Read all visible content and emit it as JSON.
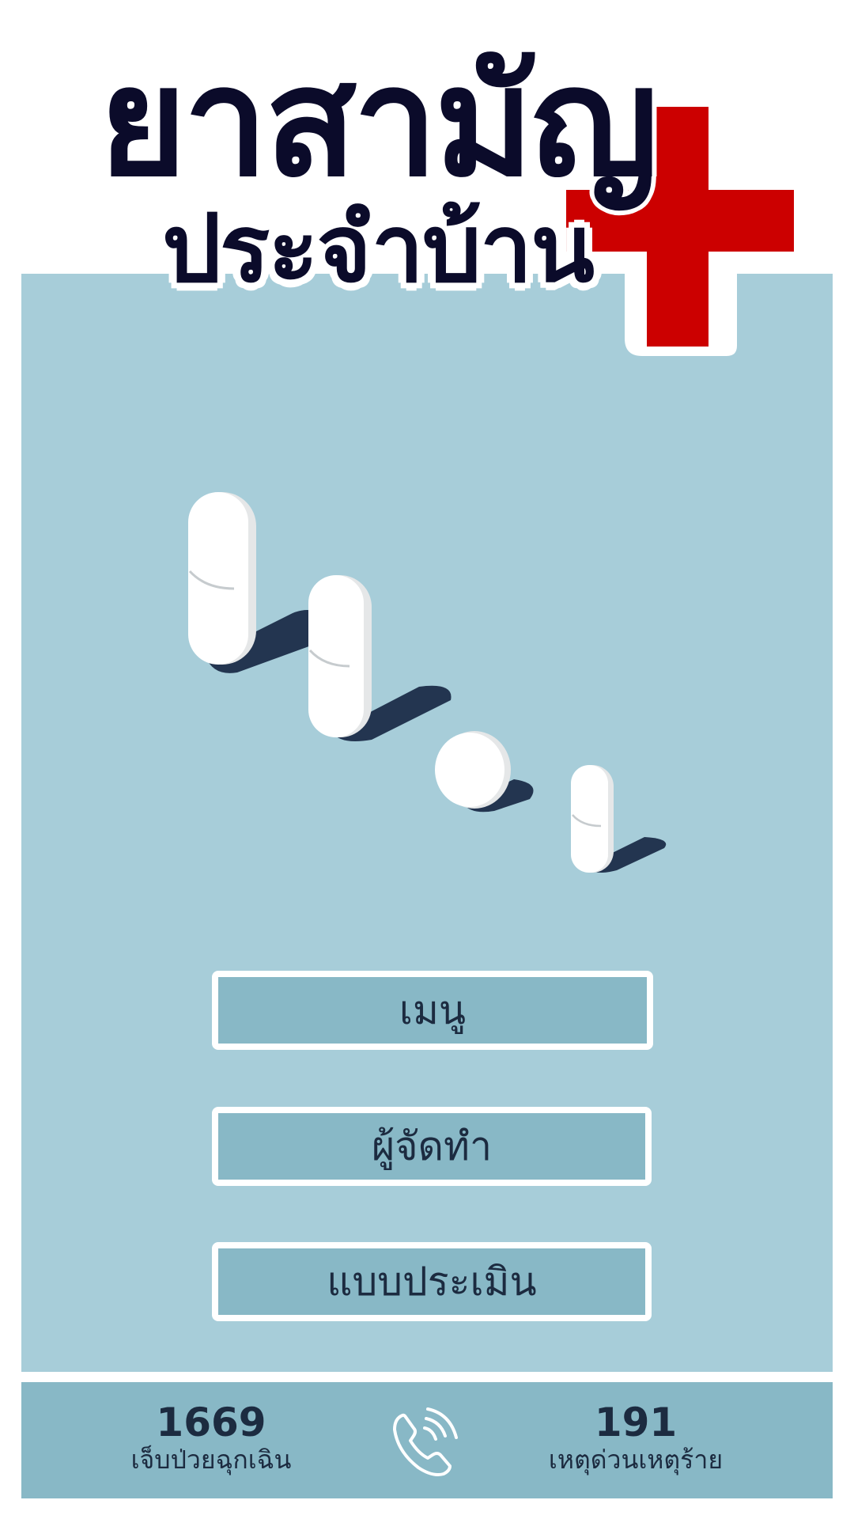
{
  "app": {
    "title": "ยาสามัญ",
    "subtitle": "ประจำบ้าน"
  },
  "menu": {
    "items": [
      {
        "label": "เมนู"
      },
      {
        "label": "ผู้จัดทำ"
      },
      {
        "label": "แบบประเมิน"
      }
    ]
  },
  "footer": {
    "hotlines": [
      {
        "number": "1669",
        "label": "เจ็บป่วยฉุกเฉิน"
      },
      {
        "number": "191",
        "label": "เหตุด่วนเหตุร้าย"
      }
    ]
  },
  "icons": {
    "cross": "red-cross-icon",
    "phone": "phone-icon",
    "pills": "pills-illustration"
  },
  "colors": {
    "panel": "#a7cdd9",
    "button": "#88b8c6",
    "title": "#0b0b2a",
    "cross": "#cc0000",
    "text": "#1c2b40"
  }
}
